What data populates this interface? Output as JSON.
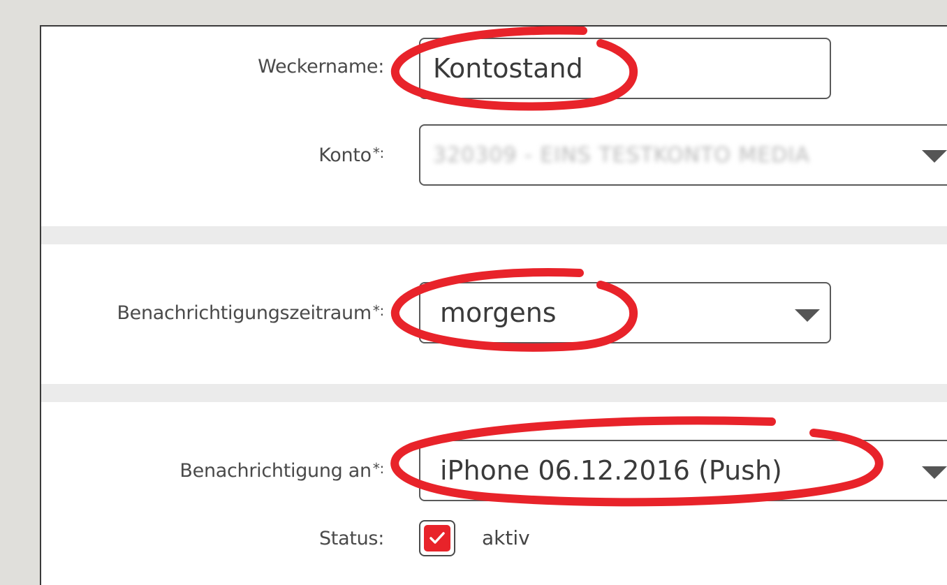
{
  "form": {
    "alarm_name": {
      "label": "Weckername:",
      "value": "Kontostand"
    },
    "account": {
      "label": "Konto",
      "required_mark": "*:",
      "value": "320309 - EINS TESTKONTO MEDIA"
    },
    "notification_period": {
      "label": "Benachrichtigungszeitraum",
      "required_mark": "*:",
      "value": "morgens"
    },
    "notify_to": {
      "label": "Benachrichtigung an",
      "required_mark": "*:",
      "value": "iPhone 06.12.2016 (Push)"
    },
    "status": {
      "label": "Status:",
      "checked": true,
      "value": "aktiv"
    }
  },
  "colors": {
    "highlight": "#e8232a",
    "checkbox_fill": "#e8232a",
    "separator": "#ebebeb",
    "background": "#e0dfdb"
  },
  "icons": {
    "dropdown": "chevron-down-icon",
    "check": "checkmark-icon"
  }
}
